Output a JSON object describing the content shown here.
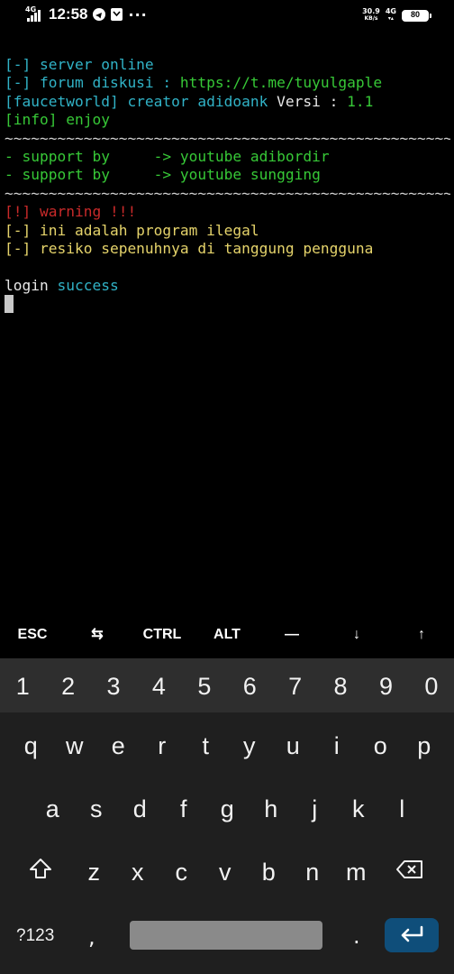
{
  "status_bar": {
    "network_left": "4G",
    "time": "12:58",
    "more": "···",
    "speed_value": "30.9",
    "speed_unit": "KB/s",
    "network_right": "4G",
    "battery": "80"
  },
  "terminal": {
    "lines": [
      [
        {
          "t": "[-] server online",
          "c": "cyan"
        }
      ],
      [
        {
          "t": "[-] forum diskusi : ",
          "c": "cyan"
        },
        {
          "t": "https://t.me/tuyulgaple",
          "c": "green"
        }
      ],
      [
        {
          "t": "[faucetworld] creator adidoank ",
          "c": "cyan"
        },
        {
          "t": "Versi : ",
          "c": "white"
        },
        {
          "t": "1.1",
          "c": "green"
        }
      ],
      [
        {
          "t": "[info] enjoy",
          "c": "green"
        }
      ],
      [
        {
          "t": "~~~~~~~~~~~~~~~~~~~~~~~~~~~~~~~~~~~~~~~~~~~~~~~~~~~~~",
          "c": "gray"
        }
      ],
      [
        {
          "t": "- support by     -> youtube adibordir",
          "c": "green"
        }
      ],
      [
        {
          "t": "- support by     -> youtube sungging",
          "c": "green"
        }
      ],
      [
        {
          "t": "~~~~~~~~~~~~~~~~~~~~~~~~~~~~~~~~~~~~~~~~~~~~~~~~~~~~~",
          "c": "gray"
        }
      ],
      [
        {
          "t": "[!] warning !!!",
          "c": "red"
        }
      ],
      [
        {
          "t": "[-] ini adalah program ilegal",
          "c": "yellow"
        }
      ],
      [
        {
          "t": "[-] resiko sepenuhnya di tanggung pengguna",
          "c": "yellow"
        }
      ],
      [
        {
          "t": "",
          "c": "white"
        }
      ],
      [
        {
          "t": "login ",
          "c": "white"
        },
        {
          "t": "success",
          "c": "cyan"
        }
      ]
    ],
    "colors": {
      "cyan": "#31b3c7",
      "green": "#37c937",
      "white": "#e8e8e8",
      "yellow": "#e6d46b",
      "red": "#c92a2a",
      "gray": "#cfcfcf"
    }
  },
  "extra_keys": [
    "ESC",
    "⇆",
    "CTRL",
    "ALT",
    "—",
    "↓",
    "↑"
  ],
  "keyboard": {
    "numbers": [
      "1",
      "2",
      "3",
      "4",
      "5",
      "6",
      "7",
      "8",
      "9",
      "0"
    ],
    "row1": [
      "q",
      "w",
      "e",
      "r",
      "t",
      "y",
      "u",
      "i",
      "o",
      "p"
    ],
    "row2": [
      "a",
      "s",
      "d",
      "f",
      "g",
      "h",
      "j",
      "k",
      "l"
    ],
    "row3": [
      "z",
      "x",
      "c",
      "v",
      "b",
      "n",
      "m"
    ],
    "symbols_label": "?123",
    "comma": ",",
    "period": ".",
    "shift_icon": "shift-icon",
    "backspace_icon": "backspace-icon",
    "enter_icon": "enter-icon",
    "enter_color": "#0f4e7a"
  }
}
